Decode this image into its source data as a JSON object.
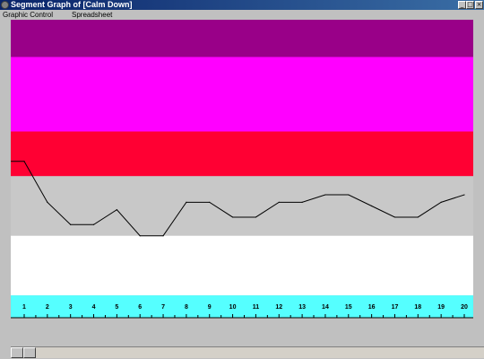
{
  "window": {
    "title": "Segment Graph of [Calm Down]",
    "minimize_glyph": "_",
    "maximize_glyph": "□",
    "close_glyph": "×"
  },
  "menu": {
    "items": [
      "Graphic Control",
      "Spreadsheet"
    ]
  },
  "graph": {
    "band_colors": [
      "#990088",
      "#ff00ff",
      "#ff0033",
      "#c8c8c8",
      "#ffffff",
      "#55ffff"
    ],
    "axis_color": "#55ffff",
    "line_color": "#000000"
  },
  "chart_data": {
    "type": "line",
    "x": [
      1,
      2,
      3,
      4,
      5,
      6,
      7,
      8,
      9,
      10,
      11,
      12,
      13,
      14,
      15,
      16,
      17,
      18,
      19,
      20
    ],
    "tick_labels": [
      "1",
      "2",
      "3",
      "4",
      "5",
      "6",
      "7",
      "8",
      "9",
      "10",
      "11",
      "12",
      "13",
      "14",
      "15",
      "16",
      "17",
      "18",
      "19",
      "20"
    ],
    "values": [
      3.8,
      4.9,
      5.5,
      5.5,
      5.1,
      5.8,
      5.8,
      4.9,
      4.9,
      5.3,
      5.3,
      4.9,
      4.9,
      4.7,
      4.7,
      5.0,
      5.3,
      5.3,
      4.9,
      4.7
    ],
    "value_range": [
      0,
      8
    ],
    "grid": false,
    "bands": [
      {
        "from": 0,
        "to": 1
      },
      {
        "from": 1,
        "to": 3
      },
      {
        "from": 3,
        "to": 4.2
      },
      {
        "from": 4.2,
        "to": 5.8
      },
      {
        "from": 5.8,
        "to": 7.4
      },
      {
        "from": 7.4,
        "to": 8
      }
    ],
    "title": "",
    "xlabel": "",
    "ylabel": ""
  }
}
